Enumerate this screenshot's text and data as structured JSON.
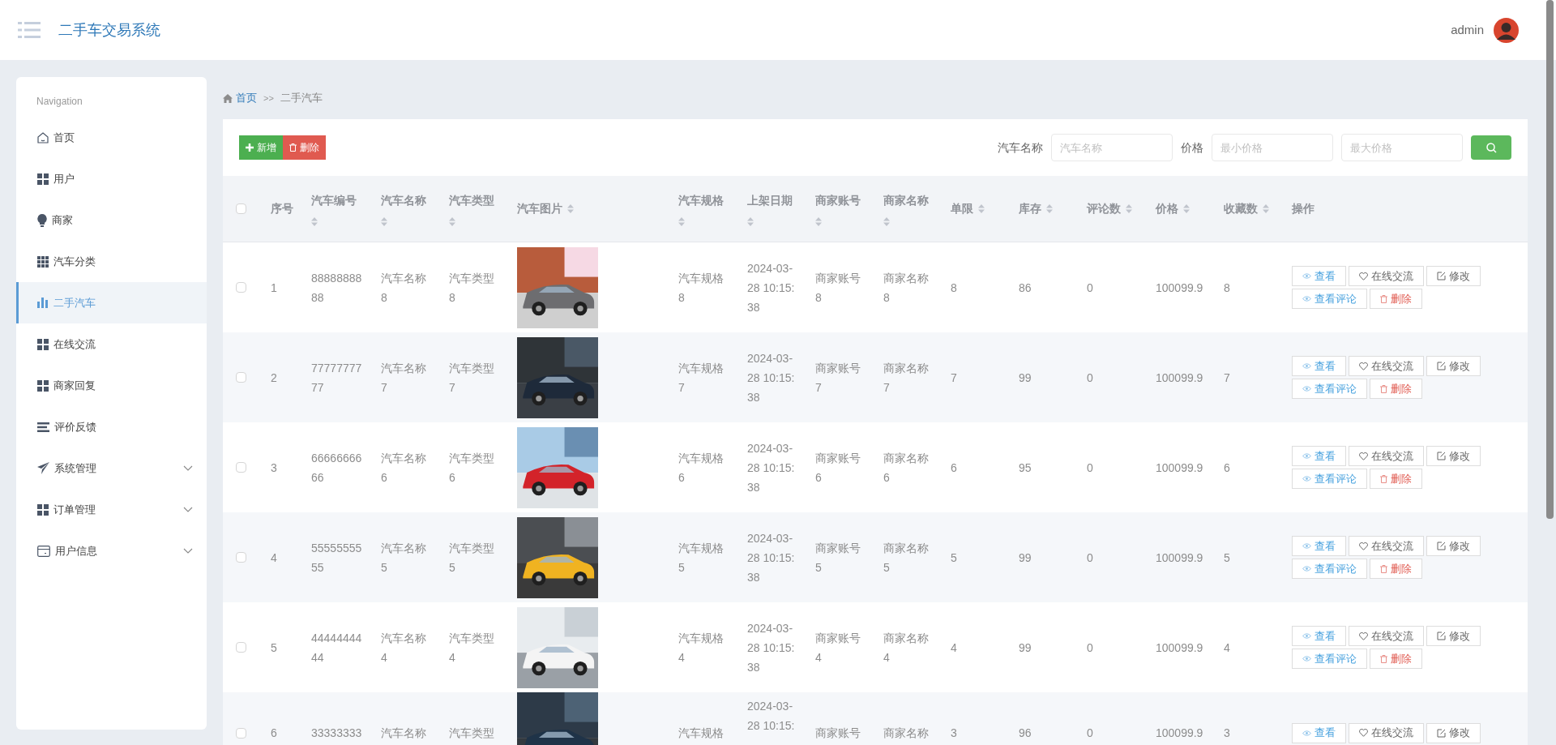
{
  "header": {
    "title": "二手车交易系统",
    "user": "admin"
  },
  "sidebar": {
    "heading": "Navigation",
    "items": [
      {
        "label": "首页",
        "kind": "link",
        "selected": false
      },
      {
        "label": "用户",
        "kind": "link",
        "selected": false
      },
      {
        "label": "商家",
        "kind": "link",
        "selected": false
      },
      {
        "label": "汽车分类",
        "kind": "link",
        "selected": false
      },
      {
        "label": "二手汽车",
        "kind": "link",
        "selected": true
      },
      {
        "label": "在线交流",
        "kind": "link",
        "selected": false
      },
      {
        "label": "商家回复",
        "kind": "link",
        "selected": false
      },
      {
        "label": "评价反馈",
        "kind": "link",
        "selected": false
      },
      {
        "label": "系统管理",
        "kind": "group",
        "expanded": false,
        "selected": false
      },
      {
        "label": "订单管理",
        "kind": "group",
        "expanded": false,
        "selected": false
      },
      {
        "label": "用户信息",
        "kind": "group",
        "expanded": false,
        "selected": false
      }
    ]
  },
  "breadcrumb": {
    "home": "首页",
    "separator": ">>",
    "current": "二手汽车"
  },
  "toolbar": {
    "buttons": [
      {
        "label": "新增",
        "kind": "add"
      },
      {
        "label": "删除",
        "kind": "delete"
      }
    ],
    "filters": [
      {
        "label": "汽车名称",
        "placeholder": "汽车名称"
      },
      {
        "label": "价格",
        "placeholder": "最小价格"
      },
      {
        "placeholder": "最大价格"
      }
    ]
  },
  "table": {
    "all_selected": false,
    "columns": [
      {
        "label": "序号",
        "sortable": false
      },
      {
        "label": "汽车编号",
        "sortable": true
      },
      {
        "label": "汽车名称",
        "sortable": true
      },
      {
        "label": "汽车类型",
        "sortable": true
      },
      {
        "label": "汽车图片",
        "sortable": true
      },
      {
        "label": "汽车规格",
        "sortable": true
      },
      {
        "label": "上架日期",
        "sortable": true
      },
      {
        "label": "商家账号",
        "sortable": true
      },
      {
        "label": "商家名称",
        "sortable": true
      },
      {
        "label": "单限",
        "sortable": true
      },
      {
        "label": "库存",
        "sortable": true
      },
      {
        "label": "评论数",
        "sortable": true
      },
      {
        "label": "价格",
        "sortable": true
      },
      {
        "label": "收藏数",
        "sortable": true
      },
      {
        "label": "操作",
        "sortable": false
      }
    ],
    "rows": [
      {
        "selected": false,
        "cells": [
          {
            "text": "1"
          },
          {
            "text": "8888888888"
          },
          {
            "text": "汽车名称8"
          },
          {
            "text": "汽车类型8"
          },
          {
            "kind": "picture"
          },
          {
            "text": "汽车规格8"
          },
          {
            "text": "2024-03-28 10:15:38"
          },
          {
            "text": "商家账号8"
          },
          {
            "text": "商家名称8"
          },
          {
            "text": "8"
          },
          {
            "text": "86"
          },
          {
            "text": "0"
          },
          {
            "text": "100099.9"
          },
          {
            "text": "8"
          }
        ],
        "actions": [
          {
            "label": "查看",
            "kind": "view"
          },
          {
            "label": "在线交流",
            "kind": "chat"
          },
          {
            "label": "修改",
            "kind": "edit"
          },
          {
            "label": "查看评论",
            "kind": "view"
          },
          {
            "label": "删除",
            "kind": "delete"
          }
        ]
      },
      {
        "selected": false,
        "cells": [
          {
            "text": "2"
          },
          {
            "text": "7777777777"
          },
          {
            "text": "汽车名称7"
          },
          {
            "text": "汽车类型7"
          },
          {
            "kind": "picture"
          },
          {
            "text": "汽车规格7"
          },
          {
            "text": "2024-03-28 10:15:38"
          },
          {
            "text": "商家账号7"
          },
          {
            "text": "商家名称7"
          },
          {
            "text": "7"
          },
          {
            "text": "99"
          },
          {
            "text": "0"
          },
          {
            "text": "100099.9"
          },
          {
            "text": "7"
          }
        ],
        "actions": [
          {
            "label": "查看",
            "kind": "view"
          },
          {
            "label": "在线交流",
            "kind": "chat"
          },
          {
            "label": "修改",
            "kind": "edit"
          },
          {
            "label": "查看评论",
            "kind": "view"
          },
          {
            "label": "删除",
            "kind": "delete"
          }
        ]
      },
      {
        "selected": false,
        "cells": [
          {
            "text": "3"
          },
          {
            "text": "6666666666"
          },
          {
            "text": "汽车名称6"
          },
          {
            "text": "汽车类型6"
          },
          {
            "kind": "picture"
          },
          {
            "text": "汽车规格6"
          },
          {
            "text": "2024-03-28 10:15:38"
          },
          {
            "text": "商家账号6"
          },
          {
            "text": "商家名称6"
          },
          {
            "text": "6"
          },
          {
            "text": "95"
          },
          {
            "text": "0"
          },
          {
            "text": "100099.9"
          },
          {
            "text": "6"
          }
        ],
        "actions": [
          {
            "label": "查看",
            "kind": "view"
          },
          {
            "label": "在线交流",
            "kind": "chat"
          },
          {
            "label": "修改",
            "kind": "edit"
          },
          {
            "label": "查看评论",
            "kind": "view"
          },
          {
            "label": "删除",
            "kind": "delete"
          }
        ]
      },
      {
        "selected": false,
        "cells": [
          {
            "text": "4"
          },
          {
            "text": "5555555555"
          },
          {
            "text": "汽车名称5"
          },
          {
            "text": "汽车类型5"
          },
          {
            "kind": "picture"
          },
          {
            "text": "汽车规格5"
          },
          {
            "text": "2024-03-28 10:15:38"
          },
          {
            "text": "商家账号5"
          },
          {
            "text": "商家名称5"
          },
          {
            "text": "5"
          },
          {
            "text": "99"
          },
          {
            "text": "0"
          },
          {
            "text": "100099.9"
          },
          {
            "text": "5"
          }
        ],
        "actions": [
          {
            "label": "查看",
            "kind": "view"
          },
          {
            "label": "在线交流",
            "kind": "chat"
          },
          {
            "label": "修改",
            "kind": "edit"
          },
          {
            "label": "查看评论",
            "kind": "view"
          },
          {
            "label": "删除",
            "kind": "delete"
          }
        ]
      },
      {
        "selected": false,
        "cells": [
          {
            "text": "5"
          },
          {
            "text": "4444444444"
          },
          {
            "text": "汽车名称4"
          },
          {
            "text": "汽车类型4"
          },
          {
            "kind": "picture"
          },
          {
            "text": "汽车规格4"
          },
          {
            "text": "2024-03-28 10:15:38"
          },
          {
            "text": "商家账号4"
          },
          {
            "text": "商家名称4"
          },
          {
            "text": "4"
          },
          {
            "text": "99"
          },
          {
            "text": "0"
          },
          {
            "text": "100099.9"
          },
          {
            "text": "4"
          }
        ],
        "actions": [
          {
            "label": "查看",
            "kind": "view"
          },
          {
            "label": "在线交流",
            "kind": "chat"
          },
          {
            "label": "修改",
            "kind": "edit"
          },
          {
            "label": "查看评论",
            "kind": "view"
          },
          {
            "label": "删除",
            "kind": "delete"
          }
        ]
      },
      {
        "selected": false,
        "cells": [
          {
            "text": "6"
          },
          {
            "text": "33333333"
          },
          {
            "text": "汽车名称"
          },
          {
            "text": "汽车类型"
          },
          {
            "kind": "picture"
          },
          {
            "text": "汽车规格"
          },
          {
            "text": "2024-03-28 10:15:"
          },
          {
            "text": "商家账号"
          },
          {
            "text": "商家名称"
          },
          {
            "text": "3"
          },
          {
            "text": "96"
          },
          {
            "text": "0"
          },
          {
            "text": "100099.9"
          },
          {
            "text": "3"
          }
        ],
        "actions": [
          {
            "label": "查看",
            "kind": "view"
          },
          {
            "label": "在线交流",
            "kind": "chat"
          },
          {
            "label": "修改",
            "kind": "edit"
          }
        ]
      }
    ]
  }
}
